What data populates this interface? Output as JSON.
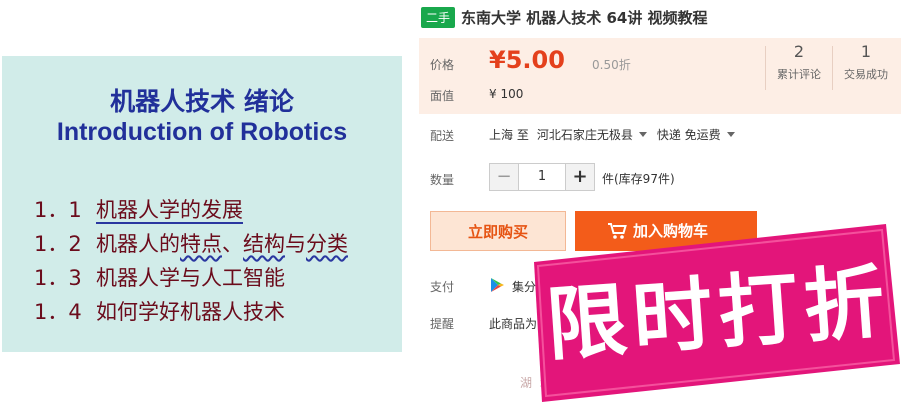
{
  "slide": {
    "title_zh": "机器人技术 绪论",
    "title_en": "Introduction of Robotics",
    "items": [
      {
        "num": "1．1",
        "text": "机器人学的发展"
      },
      {
        "num": "1．2",
        "text_a": "机器人的",
        "text_b": "特点",
        "text_c": "、",
        "text_d": "结构",
        "text_e": "与",
        "text_f": "分类"
      },
      {
        "num": "1．3",
        "text": "机器人学与人工智能"
      },
      {
        "num": "1．4",
        "text": "如何学好机器人技术"
      }
    ]
  },
  "product": {
    "tag": "二手",
    "title": "东南大学 机器人技术 64讲 视频教程",
    "price_label": "价格",
    "price": "¥5.00",
    "discount": "0.50折",
    "face_label": "面值",
    "face_value": "¥ 100",
    "reviews_count": "2",
    "reviews_label": "累计评论",
    "deals_count": "1",
    "deals_label": "交易成功",
    "ship_label": "配送",
    "ship_from": "上海 至",
    "ship_to": "河北石家庄无极县",
    "ship_method": "快递 免运费",
    "qty_label": "数量",
    "qty_minus": "−",
    "qty_value": "1",
    "qty_plus": "+",
    "stock": "件(库存97件)",
    "buy_now": "立即购买",
    "add_cart": "加入购物车",
    "pay_label": "支付",
    "pay_text": "集分宝",
    "remind_label": "提醒",
    "remind_text": "此商品为",
    "bottom_text": "湖 北 … 化 外 大 眼"
  },
  "badge": {
    "text": "限时打折",
    "color": "#e3157a"
  },
  "colors": {
    "slide_bg": "#d1ece9",
    "slide_title": "#21309a",
    "slide_item": "#6b0c1c",
    "price": "#e4401c",
    "cart_button": "#f35c1a",
    "tag": "#19a84c"
  }
}
